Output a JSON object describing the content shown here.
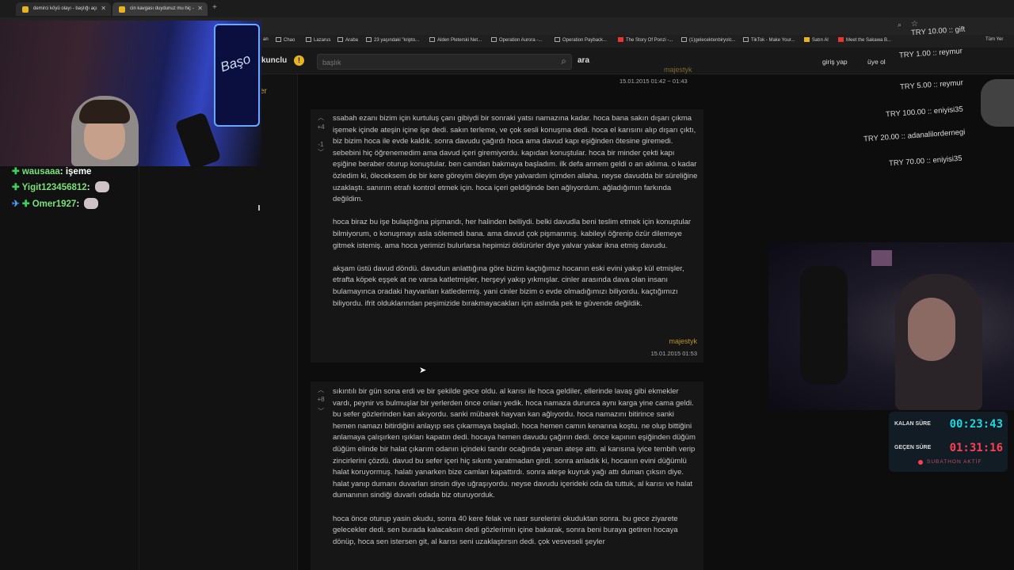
{
  "browser": {
    "tabs": [
      {
        "title": "demirci köyü olayı - başlığı açı"
      },
      {
        "title": "cin kavgası duydunuz mu hiç -"
      }
    ],
    "bookmarks": [
      "an",
      "Chao",
      "Lazarus",
      "Araba",
      "23 yaşındaki \"kripto...",
      "Alden Pleterski Net...",
      "Operation Aurora -...",
      "Operation Payback...",
      "The Story Of Ponzi -...",
      "(1)gelecektenbiryolc...",
      "TikTok - Make Your...",
      "Satın Al",
      "Meet the Sakawa B...",
      "Tüm Yer"
    ]
  },
  "site": {
    "logo_text": "kunclu",
    "search_placeholder": "başlık",
    "search_label": "ara",
    "login": "giriş yap",
    "signup": "üye ol",
    "side_fragment": "er"
  },
  "prev_entry": {
    "author": "majestyk",
    "date": "15.01.2015 01:42 ~ 01:43"
  },
  "entries": [
    {
      "up_count": "+4",
      "down_count": "-1",
      "paragraphs": [
        "ssabah ezanı bizim için kurtuluş çanı gibiydi bir sonraki yatsı namazına kadar. hoca bana sakın dışarı çıkma işemek içinde ateşin içine işe dedi. sakın terleme, ve çok sesli konuşma dedi. hoca el karısını alıp dışarı çıktı, biz bizim hoca ile evde kaldık. sonra davudu çağırdı hoca ama davud kapı eşiğinden ötesine giremedi. sebebini hiç öğrenemedim ama davud içeri giremiyordu. kapıdan konuştular. hoca bir minder çekti kapı eşiğine beraber oturup konuştular. ben camdan bakmaya başladım. ilk defa annem geldi o an aklıma. o kadar özledim ki, öleceksem de bir kere göreyim öleyim diye yalvardım içimden allaha. neyse davudda bir süreliğine uzaklaştı. sanırım etrafı kontrol etmek için. hoca içeri geldiğinde ben ağlıyordum. ağladığımın farkında değildim.",
        "hoca biraz bu işe bulaştığına pişmandı, her halinden belliydi. belki davudla beni teslim etmek için konuştular bilmiyorum, o konuşmayı asla sölemedi bana. ama davud çok pişmanmış. kabileyi öğrenip özür dilemeye gitmek istemiş. ama hoca yerimizi bulurlarsa hepimizi öldürürler diye yalvar yakar ikna etmiş davudu.",
        "akşam üstü davud döndü. davudun anlattığına göre bizim kaçtığımız hocanın eski evini yakıp kül etmişler, etrafta köpek eşşek at ne varsa katletmişler, herşeyi yakıp yıkmışlar. cinler arasında dava olan insanı bulamayınca oradaki hayvanları katledermiş. yani cinler bizim o evde olmadığımızı biliyordu. kaçtığımızı biliyordu. ifrit olduklarından peşimizide bırakmayacakları için aslında pek te güvende değildik."
      ],
      "author": "majestyk",
      "date": "15.01.2015 01:53"
    },
    {
      "up_count": "+8",
      "paragraphs": [
        "sıkıntılı bir gün sona erdi ve bir şekilde gece oldu. al karısı ile hoca geldiler, ellerinde lavaş gibi ekmekler vardı, peynir vs bulmuşlar bir yerlerden önce onları yedik. hoca namaza durunca aynı karga yine cama geldi. bu sefer gözlerinden kan akıyordu. sanki mübarek hayvan kan ağlıyordu. hoca namazını bitirince sanki hemen namazı bitirdiğini anlayıp ses çıkarmaya başladı. hoca hemen camın kenarına koştu. ne olup bittiğini anlamaya çalışırken ışıkları kapatın dedi. hocaya hemen davudu çağırın dedi. önce kapının eşiğinden düğüm düğüm elinde bir halat çıkarım odanın içindeki tandır ocağında yanan ateşe attı. al karısına iyice tembih verip zincirlerini çözdü. davud bu sefer içeri hiç sıkıntı yaratmadan girdi. sonra anladık ki, hocanın evini düğümlü halat koruyormuş. halatı yanarken bize camları kapattırdı. sonra ateşe kuyruk yağı attı duman çıksın diye. halat yanıp dumanı duvarları sinsin diye uğraşıyordu. neyse davudu içerideki oda da tuttuk, al karısı ve halat dumanının sindiği duvarlı odada biz oturuyorduk.",
        "hoca önce oturup yasin okudu, sonra 40 kere felak ve nasr surelerini okuduktan sonra. bu gece ziyarete gelecekler dedi. sen burada kalacaksın dedi gözlerimin içine bakarak, sonra beni buraya getiren hocaya dönüp, hoca sen istersen git, al karısı seni uzaklaştırsın dedi. çok vesveseli şeyler"
      ]
    }
  ],
  "chat": [
    {
      "user": "wausaaa",
      "message": "işeme"
    },
    {
      "user": "Yigit123456812",
      "message": ""
    },
    {
      "user": "Omer1927",
      "message": ""
    }
  ],
  "donations": [
    "TRY 10.00 :: gift",
    "TRY 1.00 :: reymur",
    "TRY 5.00 :: reymur",
    "TRY 100.00 :: eniyisi35",
    "TRY 20.00 :: adanalilordernegi",
    "TRY 70.00 :: eniyisi35"
  ],
  "stream": {
    "cam_brand": "Başo",
    "remaining_label": "KALAN SÜRE",
    "remaining_value": "00:23:43",
    "elapsed_label": "GEÇEN SÜRE",
    "elapsed_value": "01:31:16",
    "status": "SUBATHON AKTİF",
    "colors": {
      "remaining": "#22d6e0",
      "elapsed": "#ff3e55",
      "accent": "#b9942e"
    }
  }
}
